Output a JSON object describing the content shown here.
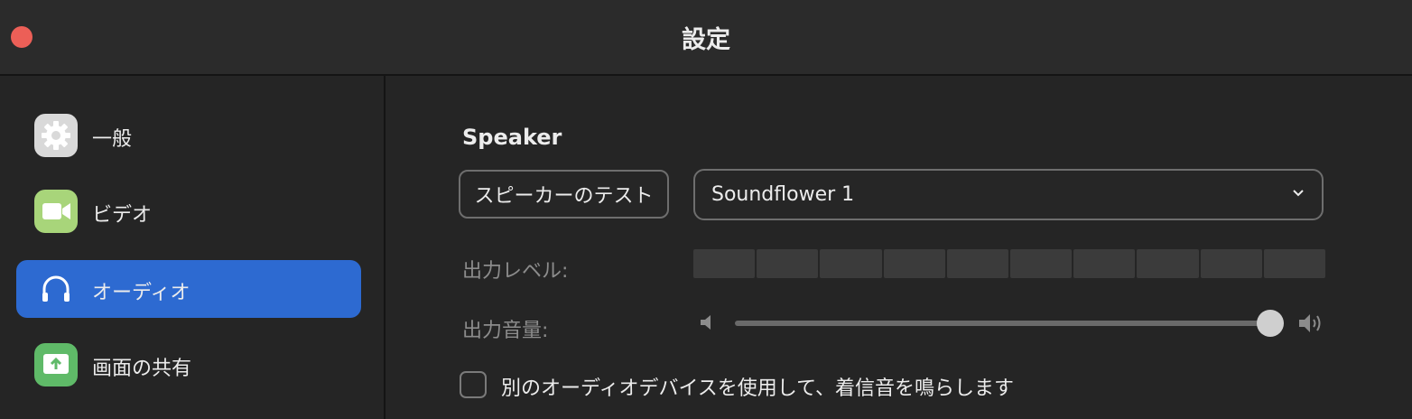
{
  "window": {
    "title": "設定",
    "close_color": "#ec5f57"
  },
  "sidebar": {
    "items": [
      {
        "label": "一般",
        "icon": "gear-icon",
        "icon_bg": "#d9d9d9",
        "active": false
      },
      {
        "label": "ビデオ",
        "icon": "video-camera-icon",
        "icon_bg": "#a8d57a",
        "active": false
      },
      {
        "label": "オーディオ",
        "icon": "headphones-icon",
        "icon_bg": "#2d6ad1",
        "active": true
      },
      {
        "label": "画面の共有",
        "icon": "share-screen-icon",
        "icon_bg": "#5fba68",
        "active": false
      }
    ],
    "active_color": "#2d6ad1"
  },
  "speaker": {
    "section_title": "Speaker",
    "test_button_label": "スピーカーのテスト",
    "device_select": {
      "selected": "Soundflower 1",
      "icon": "chevron-down-icon"
    },
    "output_level": {
      "label": "出力レベル:",
      "segments": 10,
      "level": 0
    },
    "output_volume": {
      "label": "出力音量:",
      "value": 1.0,
      "min_icon": "speaker-low-icon",
      "max_icon": "speaker-high-icon"
    }
  },
  "ringtone": {
    "checked": false,
    "label": "別のオーディオデバイスを使用して、着信音を鳴らします"
  }
}
